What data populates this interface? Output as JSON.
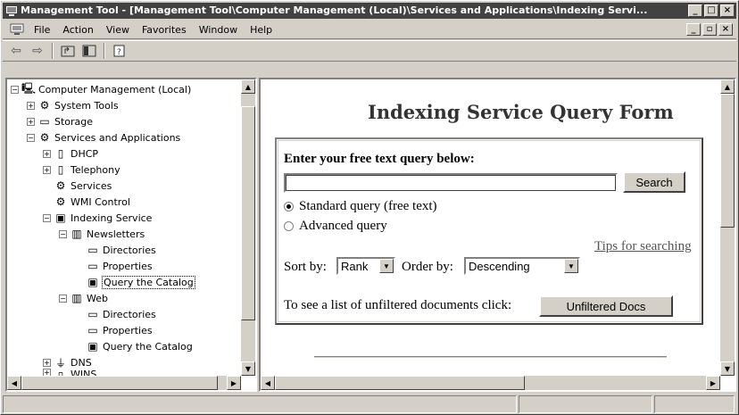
{
  "window": {
    "title": "Management Tool - [Management Tool\\Computer Management (Local)\\Services and Applications\\Indexing Servi...",
    "minimize": "_",
    "maximize": "□",
    "close": "×"
  },
  "menu": {
    "items": [
      {
        "label": "File"
      },
      {
        "label": "Action"
      },
      {
        "label": "View"
      },
      {
        "label": "Favorites"
      },
      {
        "label": "Window"
      },
      {
        "label": "Help"
      }
    ],
    "child_min": "_",
    "child_restore": "▫",
    "child_close": "×"
  },
  "toolbar": {
    "back": "⇦",
    "forward": "⇨"
  },
  "tree": {
    "items": [
      {
        "label": "Computer Management (Local)"
      },
      {
        "label": "System Tools"
      },
      {
        "label": "Storage"
      },
      {
        "label": "Services and Applications"
      },
      {
        "label": "DHCP"
      },
      {
        "label": "Telephony"
      },
      {
        "label": "Services"
      },
      {
        "label": "WMI Control"
      },
      {
        "label": "Indexing Service"
      },
      {
        "label": "Newsletters"
      },
      {
        "label": "Directories"
      },
      {
        "label": "Properties"
      },
      {
        "label": "Query the Catalog"
      },
      {
        "label": "Web"
      },
      {
        "label": "Directories"
      },
      {
        "label": "Properties"
      },
      {
        "label": "Query the Catalog"
      },
      {
        "label": "DNS"
      },
      {
        "label": "WINS"
      }
    ]
  },
  "form": {
    "heading": "Indexing Service Query Form",
    "prompt": "Enter your free text query below:",
    "query_value": "",
    "search_label": "Search",
    "radio_standard": "Standard query (free text)",
    "radio_advanced": "Advanced query",
    "tips_link": "Tips for searching",
    "sort_by_label": "Sort by:",
    "sort_by_value": "Rank",
    "order_by_label": "Order by:",
    "order_by_value": "Descending",
    "unfiltered_text": "To see a list of unfiltered documents click:",
    "unfiltered_button": "Unfiltered Docs"
  }
}
